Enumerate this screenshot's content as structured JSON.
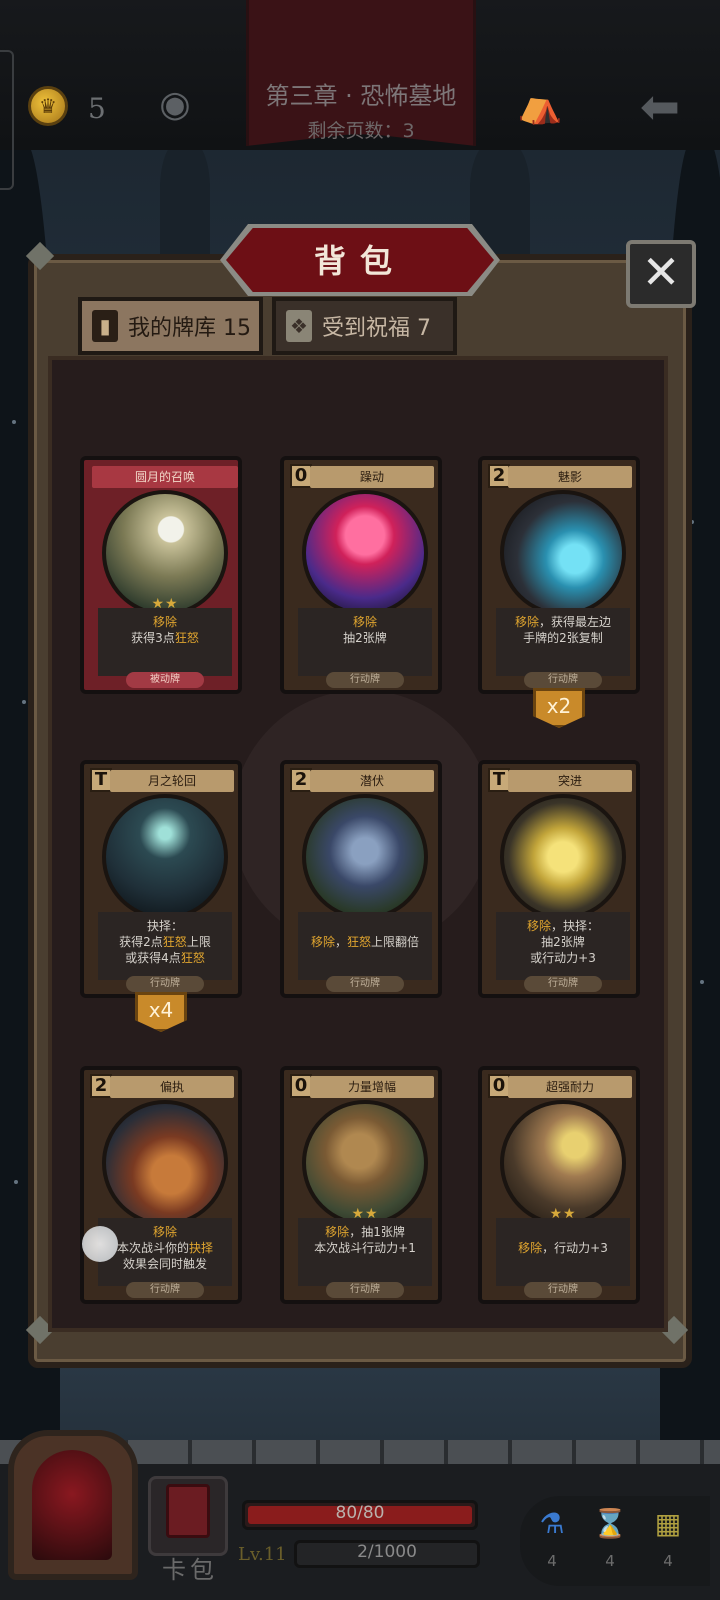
{
  "header": {
    "coins": "5",
    "chapter_title": "第三章 · 恐怖墓地",
    "pages_left": "剩余页数：3"
  },
  "panel": {
    "title": "背包",
    "close": "✕",
    "tabs": [
      {
        "label": "我的牌库 15"
      },
      {
        "label": "受到祝福 7"
      }
    ]
  },
  "cards": [
    {
      "name": "圆月的召唤",
      "cost": "",
      "desc_html": "<span class='hl'>移除</span><br>获得3点<span class='hl'>狂怒</span>",
      "stars": "★★",
      "type": "被动牌",
      "count": ""
    },
    {
      "name": "躁动",
      "cost": "0",
      "desc_html": "<span class='hl'>移除</span><br>抽2张牌",
      "stars": "",
      "type": "行动牌",
      "count": ""
    },
    {
      "name": "魅影",
      "cost": "2",
      "desc_html": "<span class='hl'>移除</span>，获得最左边<br>手牌的2张复制",
      "stars": "",
      "type": "行动牌",
      "count": "x2"
    },
    {
      "name": "月之轮回",
      "cost": "T",
      "desc_html": "抉择：<br>获得2点<span class='hl'>狂怒</span>上限<br>或获得4点<span class='hl'>狂怒</span>",
      "stars": "",
      "type": "行动牌",
      "count": "x4"
    },
    {
      "name": "潜伏",
      "cost": "2",
      "desc_html": "<br><span class='hl'>移除</span>，<span class='hl'>狂怒</span>上限翻倍",
      "stars": "",
      "type": "行动牌",
      "count": ""
    },
    {
      "name": "突进",
      "cost": "T",
      "desc_html": "<span class='hl'>移除</span>，抉择：<br>抽2张牌<br>或行动力+3",
      "stars": "",
      "type": "行动牌",
      "count": ""
    },
    {
      "name": "偏执",
      "cost": "2",
      "desc_html": "<span class='hl'>移除</span><br>本次战斗你的<span class='hl'>抉择</span><br>效果会同时触发",
      "stars": "",
      "type": "行动牌",
      "count": ""
    },
    {
      "name": "力量增幅",
      "cost": "0",
      "desc_html": "<span class='hl'>移除</span>，抽1张牌<br>本次战斗行动力+1",
      "stars": "★★",
      "type": "行动牌",
      "count": ""
    },
    {
      "name": "超强耐力",
      "cost": "0",
      "desc_html": "<br><span class='hl'>移除</span>，行动力+3",
      "stars": "★★",
      "type": "行动牌",
      "count": ""
    }
  ],
  "footer": {
    "deck_label": "卡包",
    "hp": "80/80",
    "hp_fraction": 1.0,
    "level": "Lv.11",
    "xp": "2/1000",
    "resources": [
      {
        "icon": "potion-icon",
        "count": "4"
      },
      {
        "icon": "hourglass-icon",
        "count": "4"
      },
      {
        "icon": "cards-icon",
        "count": "4"
      }
    ]
  },
  "colors": {
    "accent_gold": "#e0a52f",
    "panel_red": "#6d0f15",
    "hp_red": "#8a1c1c"
  }
}
